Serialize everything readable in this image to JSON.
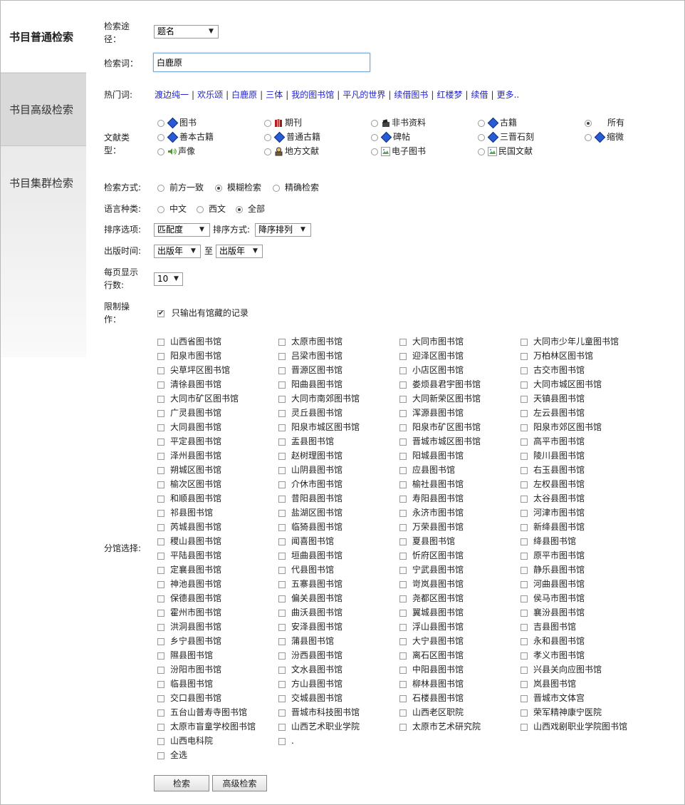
{
  "tabs": [
    "书目普通检索",
    "书目高级检索",
    "书目集群检索"
  ],
  "search_path": {
    "label": "检索途径：",
    "value": "题名"
  },
  "keyword": {
    "label": "检索词：",
    "value": "白鹿原"
  },
  "hot": {
    "label": "热门词:",
    "words": [
      "渡边纯一",
      "欢乐颂",
      "白鹿原",
      "三体",
      "我的图书馆",
      "平凡的世界",
      "续借图书",
      "红楼梦",
      "续借",
      "更多.."
    ]
  },
  "doc_type": {
    "label": "文献类型：",
    "options": [
      {
        "label": "图书",
        "icon": "blue-diamond-icon",
        "selected": false
      },
      {
        "label": "期刊",
        "icon": "journal-icon",
        "selected": false
      },
      {
        "label": "非书资料",
        "icon": "non-book-icon",
        "selected": false
      },
      {
        "label": "古籍",
        "icon": "blue-diamond-icon",
        "selected": false
      },
      {
        "label": "所有",
        "icon": "",
        "selected": true
      },
      {
        "label": "善本古籍",
        "icon": "blue-diamond-icon",
        "selected": false
      },
      {
        "label": "普通古籍",
        "icon": "blue-diamond-icon",
        "selected": false
      },
      {
        "label": "碑帖",
        "icon": "blue-diamond-icon",
        "selected": false
      },
      {
        "label": "三晋石刻",
        "icon": "blue-diamond-icon",
        "selected": false
      },
      {
        "label": "缩微",
        "icon": "blue-diamond-icon",
        "selected": false
      },
      {
        "label": "声像",
        "icon": "speaker-icon",
        "selected": false
      },
      {
        "label": "地方文献",
        "icon": "map-person-icon",
        "selected": false
      },
      {
        "label": "电子图书",
        "icon": "image-icon",
        "selected": false
      },
      {
        "label": "民国文献",
        "icon": "image-icon",
        "selected": false
      }
    ]
  },
  "search_mode": {
    "label": "检索方式:",
    "options": [
      "前方一致",
      "模糊检索",
      "精确检索"
    ],
    "selected": "模糊检索"
  },
  "language": {
    "label": "语言种类:",
    "options": [
      "中文",
      "西文",
      "全部"
    ],
    "selected": "全部"
  },
  "sort": {
    "label": "排序选项:",
    "value": "匹配度",
    "order_label": "排序方式:",
    "order_value": "降序排列"
  },
  "pub_time": {
    "label": "出版时间:",
    "from": "出版年",
    "to_label": "至",
    "to": "出版年"
  },
  "per_page": {
    "label": "每页显示行数:",
    "value": "10"
  },
  "restrict": {
    "label": "限制操作：",
    "option": "只输出有馆藏的记录",
    "checked": true
  },
  "branches": {
    "label": "分馆选择:",
    "items": [
      "山西省图书馆",
      "太原市图书馆",
      "大同市图书馆",
      "大同市少年儿童图书馆",
      "阳泉市图书馆",
      "吕梁市图书馆",
      "迎泽区图书馆",
      "万柏林区图书馆",
      "尖草坪区图书馆",
      "晋源区图书馆",
      "小店区图书馆",
      "古交市图书馆",
      "清徐县图书馆",
      "阳曲县图书馆",
      "娄烦县君宇图书馆",
      "大同市城区图书馆",
      "大同市矿区图书馆",
      "大同市南郊图书馆",
      "大同新荣区图书馆",
      "天镇县图书馆",
      "广灵县图书馆",
      "灵丘县图书馆",
      "浑源县图书馆",
      "左云县图书馆",
      "大同县图书馆",
      "阳泉市城区图书馆",
      "阳泉市矿区图书馆",
      "阳泉市郊区图书馆",
      "平定县图书馆",
      "盂县图书馆",
      "晋城市城区图书馆",
      "高平市图书馆",
      "泽州县图书馆",
      "赵树理图书馆",
      "阳城县图书馆",
      "陵川县图书馆",
      "朔城区图书馆",
      "山阴县图书馆",
      "应县图书馆",
      "右玉县图书馆",
      "榆次区图书馆",
      "介休市图书馆",
      "榆社县图书馆",
      "左权县图书馆",
      "和顺县图书馆",
      "昔阳县图书馆",
      "寿阳县图书馆",
      "太谷县图书馆",
      "祁县图书馆",
      "盐湖区图书馆",
      "永济市图书馆",
      "河津市图书馆",
      "芮城县图书馆",
      "临猗县图书馆",
      "万荣县图书馆",
      "新绛县图书馆",
      "稷山县图书馆",
      "闻喜图书馆",
      "夏县图书馆",
      "绛县图书馆",
      "平陆县图书馆",
      "垣曲县图书馆",
      "忻府区图书馆",
      "原平市图书馆",
      "定襄县图书馆",
      "代县图书馆",
      "宁武县图书馆",
      "静乐县图书馆",
      "神池县图书馆",
      "五寨县图书馆",
      "岢岚县图书馆",
      "河曲县图书馆",
      "保德县图书馆",
      "偏关县图书馆",
      "尧都区图书馆",
      "侯马市图书馆",
      "霍州市图书馆",
      "曲沃县图书馆",
      "翼城县图书馆",
      "襄汾县图书馆",
      "洪洞县图书馆",
      "安泽县图书馆",
      "浮山县图书馆",
      "吉县图书馆",
      "乡宁县图书馆",
      "蒲县图书馆",
      "大宁县图书馆",
      "永和县图书馆",
      "隰县图书馆",
      "汾西县图书馆",
      "离石区图书馆",
      "孝义市图书馆",
      "汾阳市图书馆",
      "文水县图书馆",
      "中阳县图书馆",
      "兴县关向应图书馆",
      "临县图书馆",
      "方山县图书馆",
      "柳林县图书馆",
      "岚县图书馆",
      "交口县图书馆",
      "交城县图书馆",
      "石楼县图书馆",
      "晋城市文体宫",
      "五台山普寿寺图书馆",
      "晋城市科技图书馆",
      "山西老区职院",
      "荣军精神康宁医院",
      "太原市盲童学校图书馆",
      "山西艺术职业学院",
      "太原市艺术研究院",
      "山西戏剧职业学院图书馆",
      "山西电科院",
      "."
    ],
    "select_all": "全选"
  },
  "buttons": {
    "search": "检索",
    "advanced": "高级检索"
  }
}
